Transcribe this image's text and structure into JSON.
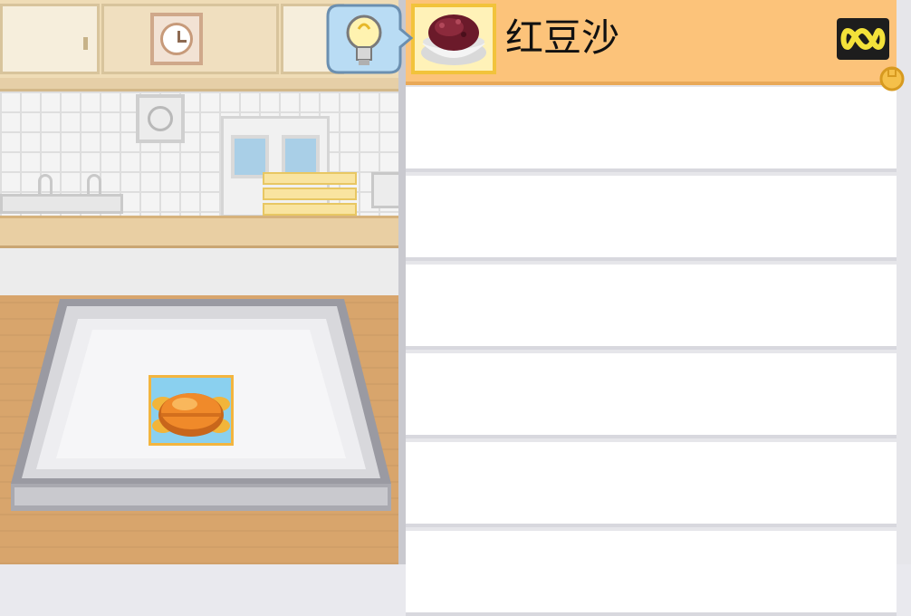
{
  "scene": {
    "background_icons": [
      "wall-clock-icon",
      "vent-fan-icon",
      "refrigerator-icon",
      "sink-faucet-icon",
      "plate-stack-icon"
    ],
    "tray_item_icon": "baked-bun-icon"
  },
  "hint_button": {
    "icon": "lightbulb-icon"
  },
  "recipe_list": {
    "selected_index": 0,
    "items": [
      {
        "label": "红豆沙",
        "icon": "red-bean-paste-bowl-icon",
        "quantity_icon": "infinity-icon"
      },
      {
        "label": ""
      },
      {
        "label": ""
      },
      {
        "label": ""
      },
      {
        "label": ""
      },
      {
        "label": ""
      },
      {
        "label": ""
      }
    ]
  },
  "colors": {
    "selected_row": "#fcc37a",
    "thumb_border": "#f2c33b",
    "table_wood": "#d8a56c",
    "hint_bubble": "#b9dcf4"
  }
}
